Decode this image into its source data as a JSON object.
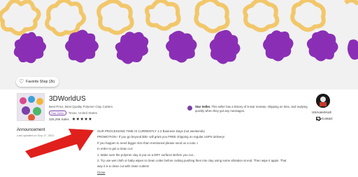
{
  "banner": {
    "favorite_label": "Favorite Shop (2k)"
  },
  "shop": {
    "name": "3DWorldUS",
    "tagline": "Best Price, Best Quality Polymer Clay Cutters",
    "star_seller_badge": "Star Seller",
    "location": "Texas, United States",
    "sales": "325,296 Sales",
    "stars": "★★★★★"
  },
  "star_seller": {
    "title": "Star Seller.",
    "text": "This seller has a history of 5-star reviews, shipping on time, and replying quickly when they got any messages."
  },
  "owner": {
    "name": "USAoneSALE",
    "contact_label": "Contact"
  },
  "announcement": {
    "title": "Announcement",
    "updated": "Last updated on Sep 17, 2021",
    "lines": [
      "OUR PROCESSING TIME IS CURRENTLY 1-2 Business Days (not weekends)",
      "PROMOTION ! If you go beyond $35- will grant you FREE shipping on regular USPS delivery!",
      "If you happen to need bigger size than mentioned please send us a note..!",
      "In order to get a clean cut:",
      "1. Make sure the polymer clay is put on a DRY surface! Before you cut...",
      "2. Try use wet cloth or baby wipes to clean cutter before cutting pushing then into clay using some vibration at end. Then wipe it again. That",
      "way it is a clean cut with clean cutters!"
    ],
    "close_label": "Close"
  },
  "colors": {
    "cutter": "#f2c76a",
    "clay": "#8a2fb5",
    "banner_bg": "#f1f1f1",
    "arrow": "#e0201c",
    "accent": "#7b3fa8"
  }
}
